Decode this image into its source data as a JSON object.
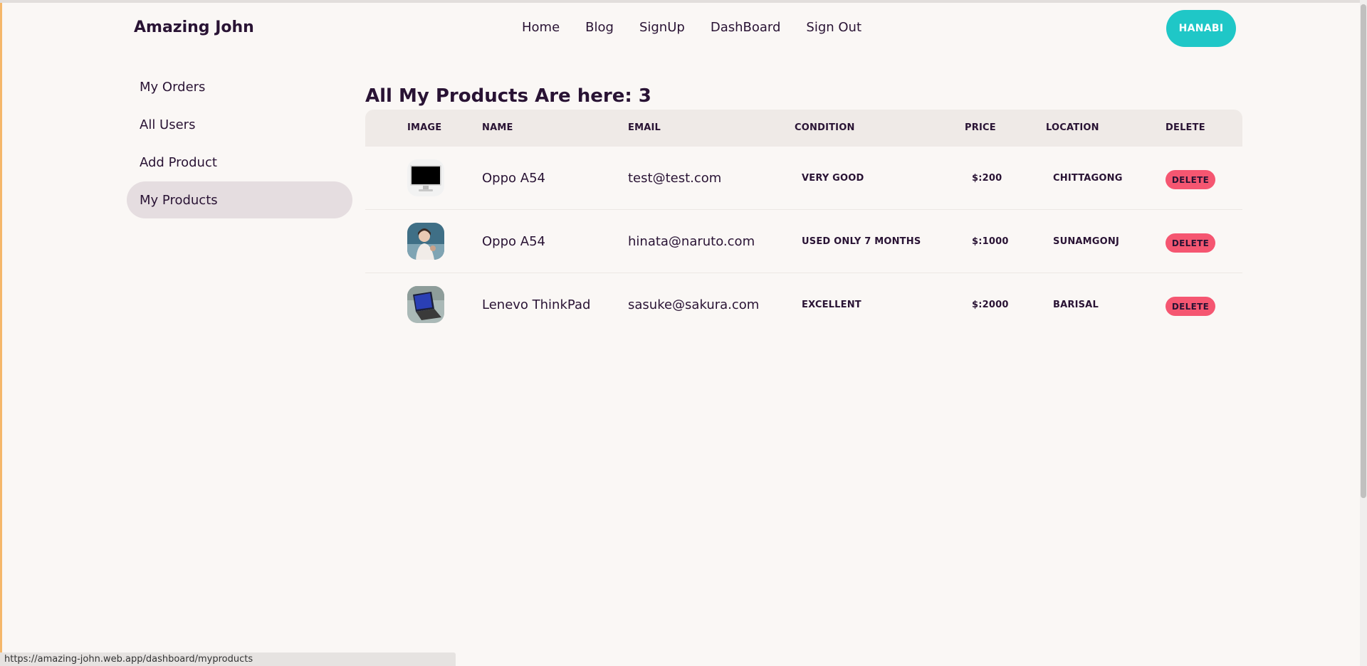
{
  "navbar": {
    "brand": "Amazing John",
    "links": [
      "Home",
      "Blog",
      "SignUp",
      "DashBoard",
      "Sign Out"
    ],
    "user_button": "HANABI"
  },
  "sidebar": {
    "items": [
      {
        "label": "My Orders",
        "active": false
      },
      {
        "label": "All Users",
        "active": false
      },
      {
        "label": "Add Product",
        "active": false
      },
      {
        "label": "My Products",
        "active": true
      }
    ]
  },
  "main": {
    "title": "All My Products Are here: 3",
    "columns": [
      "IMAGE",
      "NAME",
      "EMAIL",
      "CONDITION",
      "PRICE",
      "LOCATION",
      "DELETE"
    ],
    "rows": [
      {
        "name": "Oppo A54",
        "email": "test@test.com",
        "condition": "VERY GOOD",
        "price": "$:200",
        "location": "CHITTAGONG",
        "delete": "DELETE",
        "image": "monitor-photo"
      },
      {
        "name": "Oppo A54",
        "email": "hinata@naruto.com",
        "condition": "USED ONLY 7 MONTHS",
        "price": "$:1000",
        "location": "SUNAMGONJ",
        "delete": "DELETE",
        "image": "person-photo"
      },
      {
        "name": "Lenevo ThinkPad",
        "email": "sasuke@sakura.com",
        "condition": "EXCELLENT",
        "price": "$:2000",
        "location": "BARISAL",
        "delete": "DELETE",
        "image": "laptop-photo"
      }
    ]
  },
  "status_bar": {
    "url": "https://amazing-john.web.app/dashboard/myproducts"
  },
  "colors": {
    "background": "#faf7f5",
    "accent": "#1fc7c7",
    "delete": "#f55671",
    "text": "#291334",
    "sidebar_active": "#e5dde0"
  }
}
